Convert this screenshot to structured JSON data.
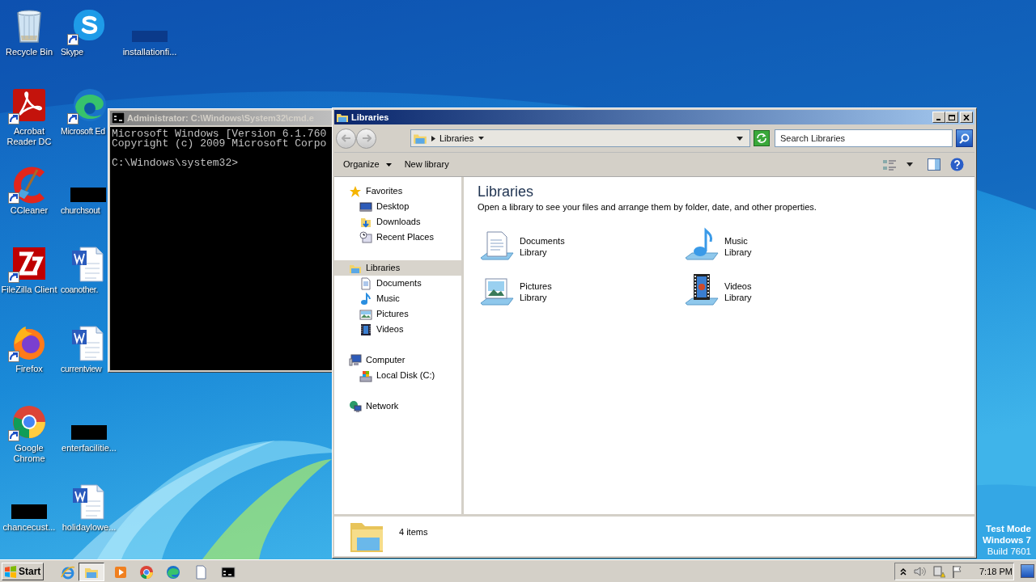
{
  "desktop": {
    "icons": [
      {
        "label": "Recycle Bin",
        "shortcut": false
      },
      {
        "label": "Skype",
        "shortcut": true
      },
      {
        "label": "installationfi...",
        "shortcut": false
      },
      {
        "label": "Acrobat Reader DC",
        "shortcut": true
      },
      {
        "label": "Microsoft Ed",
        "shortcut": true
      },
      {
        "label": "CCleaner",
        "shortcut": true
      },
      {
        "label": "churchsout",
        "shortcut": false
      },
      {
        "label": "FileZilla Client",
        "shortcut": true
      },
      {
        "label": "coanother.",
        "shortcut": false
      },
      {
        "label": "Firefox",
        "shortcut": true
      },
      {
        "label": "currentview",
        "shortcut": false
      },
      {
        "label": "Google Chrome",
        "shortcut": true
      },
      {
        "label": "enterfacilitie...",
        "shortcut": false
      },
      {
        "label": "chancecust...",
        "shortcut": false
      },
      {
        "label": "holidaylowe...",
        "shortcut": false
      }
    ],
    "edition_text": [
      "Test Mode",
      "Windows 7",
      "Build 7601"
    ]
  },
  "cmd_window": {
    "title": "Administrator: C:\\Windows\\System32\\cmd.e",
    "active": false,
    "lines": [
      "Microsoft Windows [Version 6.1.760",
      "Copyright (c) 2009 Microsoft Corpo"
    ],
    "prompt": "C:\\Windows\\system32>"
  },
  "explorer": {
    "title": "Libraries",
    "active": true,
    "address": "Libraries",
    "search": {
      "placeholder": "Search Libraries"
    },
    "toolbar": [
      {
        "label": "Organize",
        "dropdown": true
      },
      {
        "label": "New library",
        "dropdown": false
      }
    ],
    "nav": [
      {
        "label": "Favorites",
        "selected": false,
        "children": [
          {
            "label": "Desktop",
            "selected": false
          },
          {
            "label": "Downloads",
            "selected": false
          },
          {
            "label": "Recent Places",
            "selected": false
          }
        ]
      },
      {
        "label": "Libraries",
        "selected": true,
        "children": [
          {
            "label": "Documents",
            "selected": false
          },
          {
            "label": "Music",
            "selected": false
          },
          {
            "label": "Pictures",
            "selected": false
          },
          {
            "label": "Videos",
            "selected": false
          }
        ]
      },
      {
        "label": "Computer",
        "selected": false,
        "children": [
          {
            "label": "Local Disk (C:)",
            "selected": false
          }
        ]
      },
      {
        "label": "Network",
        "selected": false
      }
    ],
    "heading": "Libraries",
    "description": "Open a library to see your files and arrange them by folder, date, and other properties.",
    "libraries": [
      {
        "name": "Documents",
        "type": "Library"
      },
      {
        "name": "Music",
        "type": "Library"
      },
      {
        "name": "Pictures",
        "type": "Library"
      },
      {
        "name": "Videos",
        "type": "Library"
      }
    ],
    "status": "4 items"
  },
  "taskbar": {
    "start": "Start",
    "items": [
      {
        "selected": false
      },
      {
        "selected": true
      },
      {
        "selected": false
      },
      {
        "selected": false
      },
      {
        "selected": false
      },
      {
        "selected": false
      },
      {
        "selected": false
      }
    ],
    "clock": "7:18 PM"
  }
}
